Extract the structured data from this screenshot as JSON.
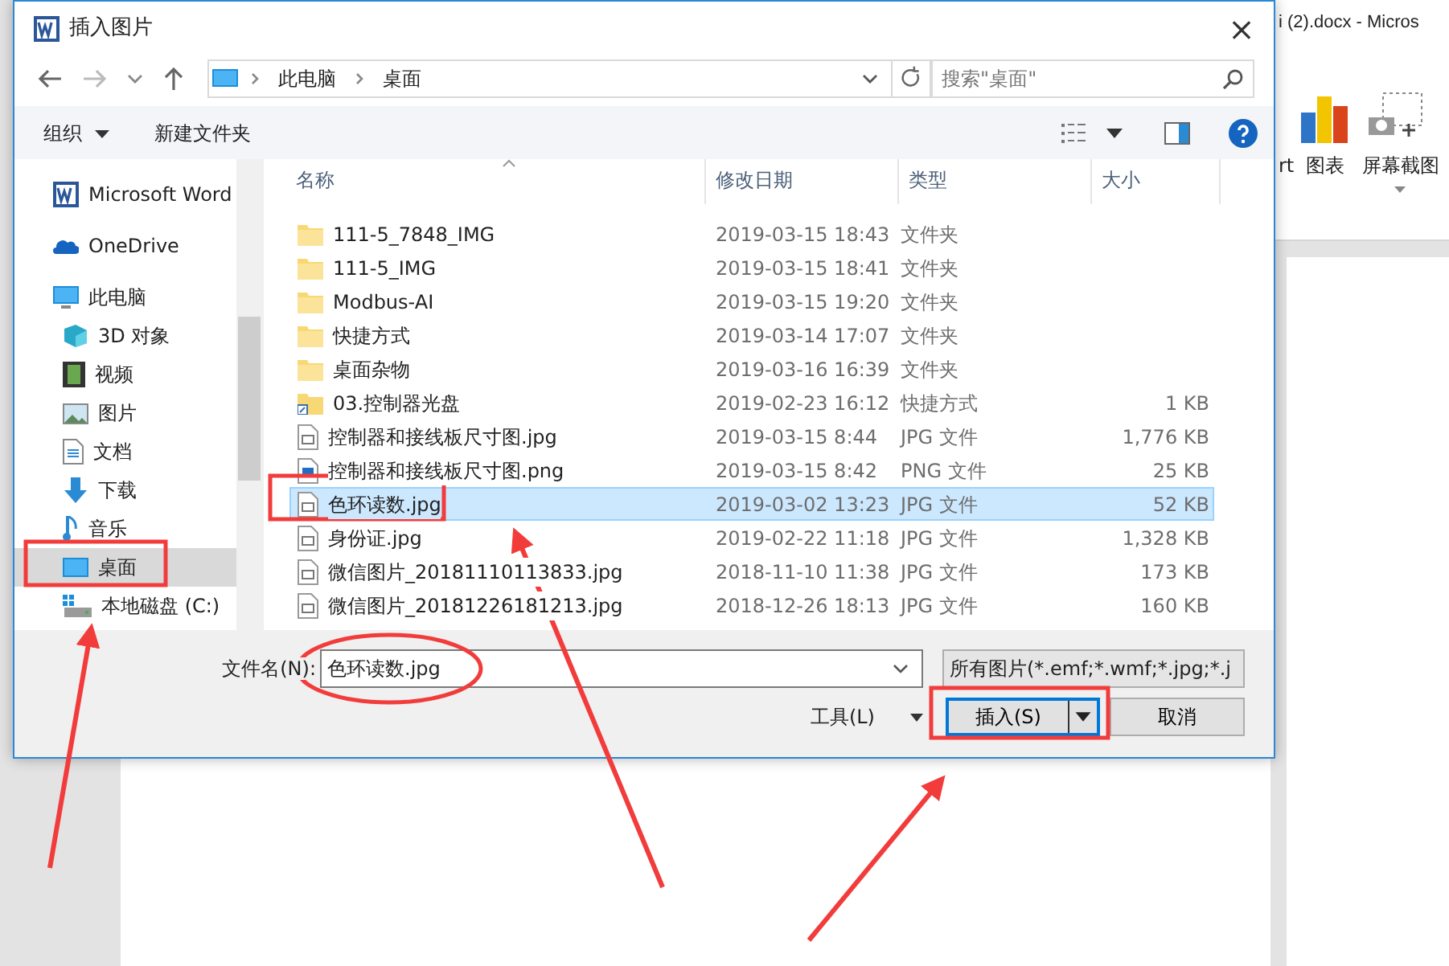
{
  "word_window": {
    "title": "i (2).docx - Micros",
    "ribbon": [
      {
        "label": "rt",
        "kind": "cut"
      },
      {
        "label": "图表",
        "kind": "chart"
      },
      {
        "label": "屏幕截图",
        "kind": "screenshot"
      }
    ]
  },
  "dialog": {
    "title": "插入图片",
    "close": "×",
    "path": [
      "此电脑",
      "桌面"
    ],
    "search": {
      "placeholder": "搜索\"桌面\""
    },
    "toolbar": [
      "组织",
      "新建文件夹"
    ]
  },
  "sidebar": [
    {
      "label": "Microsoft Word",
      "kind": "word",
      "selected": false
    },
    {
      "label": "OneDrive",
      "kind": "onedrive",
      "selected": false
    },
    {
      "label": "此电脑",
      "kind": "pc",
      "selected": false,
      "children": [
        {
          "label": "3D 对象",
          "kind": "cube",
          "selected": false
        },
        {
          "label": "视频",
          "kind": "video",
          "selected": false
        },
        {
          "label": "图片",
          "kind": "picture",
          "selected": false
        },
        {
          "label": "文档",
          "kind": "document",
          "selected": false
        },
        {
          "label": "下载",
          "kind": "download",
          "selected": false
        },
        {
          "label": "音乐",
          "kind": "music",
          "selected": false
        },
        {
          "label": "桌面",
          "kind": "desktop",
          "selected": true
        },
        {
          "label": "本地磁盘 (C:)",
          "kind": "disk",
          "selected": false
        }
      ]
    }
  ],
  "columns": [
    "名称",
    "修改日期",
    "类型",
    "大小"
  ],
  "files": [
    {
      "name": "111-5_7848_IMG",
      "date": "2019-03-15 18:43",
      "type": "文件夹",
      "kind": "folder",
      "selected": false
    },
    {
      "name": "111-5_IMG",
      "date": "2019-03-15 18:41",
      "type": "文件夹",
      "kind": "folder",
      "selected": false
    },
    {
      "name": "Modbus-AI",
      "date": "2019-03-15 19:20",
      "type": "文件夹",
      "kind": "folder",
      "selected": false
    },
    {
      "name": "快捷方式",
      "date": "2019-03-14 17:07",
      "type": "文件夹",
      "kind": "folder",
      "selected": false
    },
    {
      "name": "桌面杂物",
      "date": "2019-03-16 16:39",
      "type": "文件夹",
      "kind": "folder",
      "selected": false
    },
    {
      "name": "03.控制器光盘",
      "date": "2019-02-23 16:12",
      "type": "快捷方式",
      "size": "1 KB",
      "kind": "shortcut",
      "selected": false
    },
    {
      "name": "控制器和接线板尺寸图.jpg",
      "date": "2019-03-15 8:44",
      "type": "JPG 文件",
      "size": "1,776 KB",
      "kind": "jpg",
      "selected": false
    },
    {
      "name": "控制器和接线板尺寸图.png",
      "date": "2019-03-15 8:42",
      "type": "PNG 文件",
      "size": "25 KB",
      "kind": "png",
      "selected": false
    },
    {
      "name": "色环读数.jpg",
      "date": "2019-03-02 13:23",
      "type": "JPG 文件",
      "size": "52 KB",
      "kind": "jpg",
      "selected": true
    },
    {
      "name": "身份证.jpg",
      "date": "2019-02-22 11:18",
      "type": "JPG 文件",
      "size": "1,328 KB",
      "kind": "jpg",
      "selected": false
    },
    {
      "name": "微信图片_20181110113833.jpg",
      "date": "2018-11-10 11:38",
      "type": "JPG 文件",
      "size": "173 KB",
      "kind": "jpg",
      "selected": false
    },
    {
      "name": "微信图片_20181226181213.jpg",
      "date": "2018-12-26 18:13",
      "type": "JPG 文件",
      "size": "160 KB",
      "kind": "jpg",
      "selected": false
    }
  ],
  "filename": {
    "label": "文件名(N):",
    "value": "色环读数.jpg"
  },
  "filetype": "所有图片(*.emf;*.wmf;*.jpg;*.j",
  "tools": "工具(L)",
  "buttons": [
    {
      "label": "插入(S)",
      "kind": "split",
      "selected": true
    },
    {
      "label": "取消",
      "kind": "plain",
      "selected": false
    }
  ]
}
